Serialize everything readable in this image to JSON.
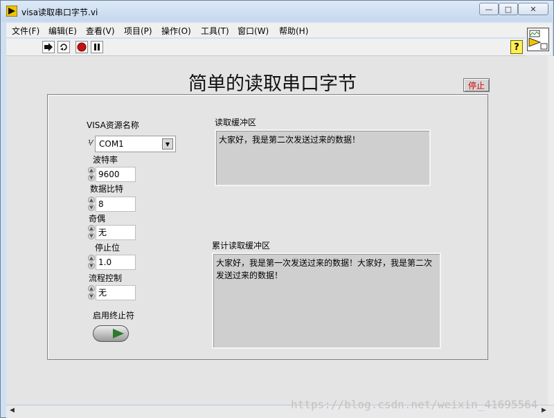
{
  "window": {
    "title": "visa读取串口字节.vi",
    "controls": {
      "minimize": "—",
      "maximize": "□",
      "close": "✕"
    }
  },
  "menu": {
    "items": [
      "文件(F)",
      "编辑(E)",
      "查看(V)",
      "项目(P)",
      "操作(O)",
      "工具(T)",
      "窗口(W)",
      "帮助(H)"
    ]
  },
  "toolbar": {
    "run_icon": "run-arrow-icon",
    "run_continuously_icon": "run-continuously-icon",
    "abort_icon": "abort-icon",
    "pause_icon": "pause-icon",
    "help": "?"
  },
  "panel": {
    "title": "简单的读取串口字节",
    "stop_button": "停止",
    "visa_label": "VISA资源名称",
    "visa_io_glyph": "⅟",
    "visa_value": "COM1",
    "baud_label": "波特率",
    "baud_value": "9600",
    "databits_label": "数据比特",
    "databits_value": "8",
    "parity_label": "奇偶",
    "parity_value": "无",
    "stopbits_label": "停止位",
    "stopbits_value": "1.0",
    "flow_label": "流程控制",
    "flow_value": "无",
    "termchar_label": "启用终止符",
    "read_buffer_label": "读取缓冲区",
    "read_buffer_value": "大家好，我是第二次发送过来的数据！",
    "cumulative_label": "累计读取缓冲区",
    "cumulative_value": "大家好，我是第一次发送过来的数据！大家好，我是第二次发送过来的数据！"
  },
  "watermark": "https://blog.csdn.net/weixin_41695564",
  "colors": {
    "stop_text": "#d10000",
    "panel_bg": "#e4e4e4",
    "buffer_bg": "#cfcfcf",
    "led": "#2d7a2d"
  }
}
